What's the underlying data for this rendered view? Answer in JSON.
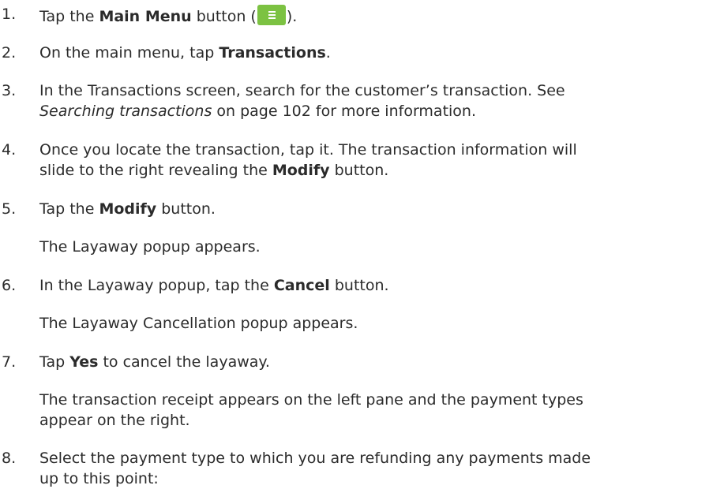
{
  "steps": [
    {
      "num": "1.",
      "lines": [
        [
          "Tap the ",
          {
            "b": "Main Menu"
          },
          " button (",
          {
            "icon": "main-menu-icon"
          },
          ")."
        ]
      ]
    },
    {
      "num": "2.",
      "lines": [
        [
          "On the main menu, tap ",
          {
            "b": "Transactions"
          },
          "."
        ]
      ]
    },
    {
      "num": "3.",
      "lines": [
        [
          "In the Transactions screen, search for the customer’s transaction. See"
        ],
        [
          {
            "i": "Searching transactions"
          },
          " on page 102 for more information."
        ]
      ]
    },
    {
      "num": "4.",
      "lines": [
        [
          "Once you locate the transaction, tap it. The transaction information will"
        ],
        [
          "slide to the right revealing the ",
          {
            "b": "Modify"
          },
          " button."
        ]
      ]
    },
    {
      "num": "5.",
      "lines": [
        [
          "Tap the ",
          {
            "b": "Modify"
          },
          " button."
        ]
      ]
    },
    {
      "num": "",
      "lines": [
        [
          "The Layaway popup appears."
        ]
      ]
    },
    {
      "num": "6.",
      "lines": [
        [
          "In the Layaway popup, tap the ",
          {
            "b": "Cancel"
          },
          " button."
        ]
      ]
    },
    {
      "num": "",
      "lines": [
        [
          "The Layaway Cancellation popup appears."
        ]
      ]
    },
    {
      "num": "7.",
      "lines": [
        [
          "Tap ",
          {
            "b": "Yes"
          },
          " to cancel the layaway."
        ]
      ]
    },
    {
      "num": "",
      "lines": [
        [
          "The transaction receipt appears on the left pane and the payment types"
        ],
        [
          "appear on the right."
        ]
      ]
    },
    {
      "num": "8.",
      "lines": [
        [
          "Select the payment type to which you are refunding any payments made"
        ],
        [
          "up to this point:"
        ]
      ]
    }
  ]
}
